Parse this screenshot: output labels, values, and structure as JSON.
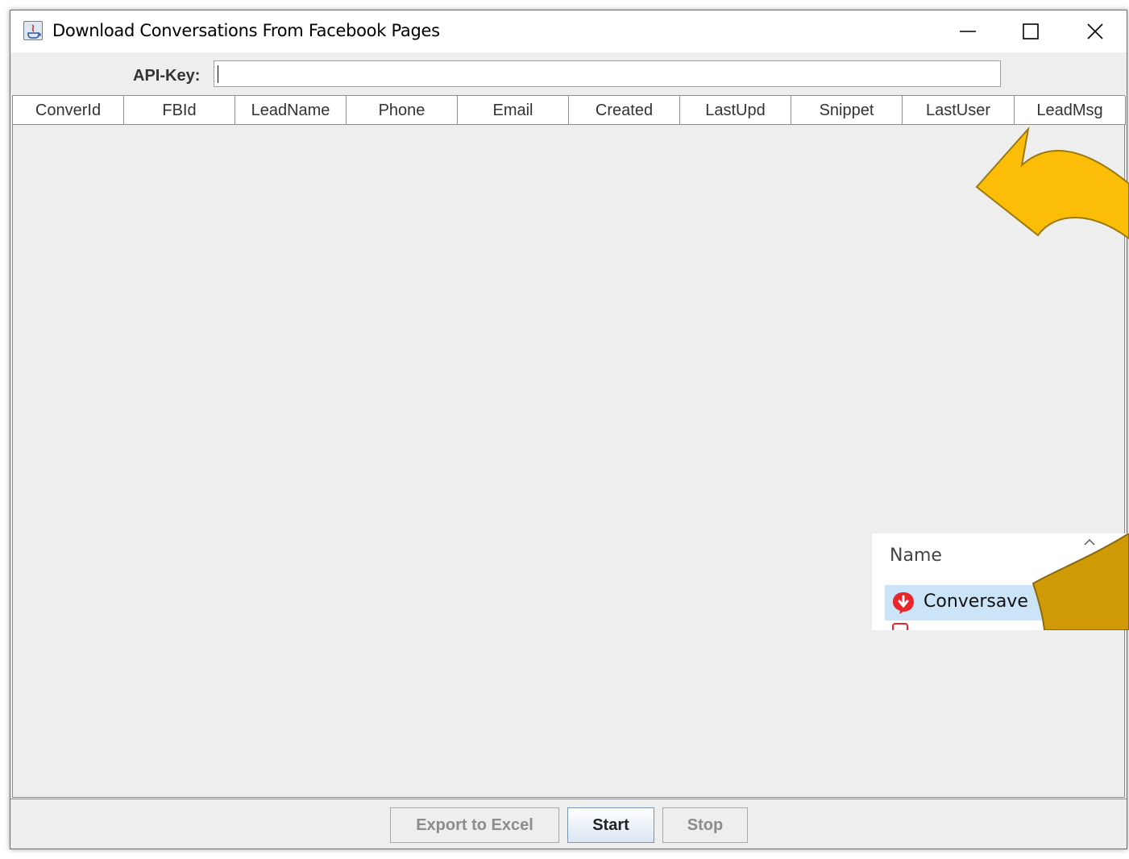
{
  "window": {
    "title": "Download Conversations From Facebook Pages",
    "controls": [
      "minimize-icon",
      "maximize-icon",
      "close-icon"
    ]
  },
  "api": {
    "label": "API-Key:",
    "value": ""
  },
  "table": {
    "columns": [
      "ConverId",
      "FBId",
      "LeadName",
      "Phone",
      "Email",
      "Created",
      "LastUpd",
      "Snippet",
      "LastUser",
      "LeadMsg"
    ],
    "rows": []
  },
  "buttons": {
    "export_label": "Export to Excel",
    "start_label": "Start",
    "stop_label": "Stop"
  },
  "inset": {
    "header": "Name",
    "item_label": "Conversave",
    "item_icon": "conversave-download-icon",
    "highlight_color": "#cce4f7"
  },
  "colors": {
    "arrow": "#fbbd08",
    "arrow_dark": "#cf9a06"
  }
}
